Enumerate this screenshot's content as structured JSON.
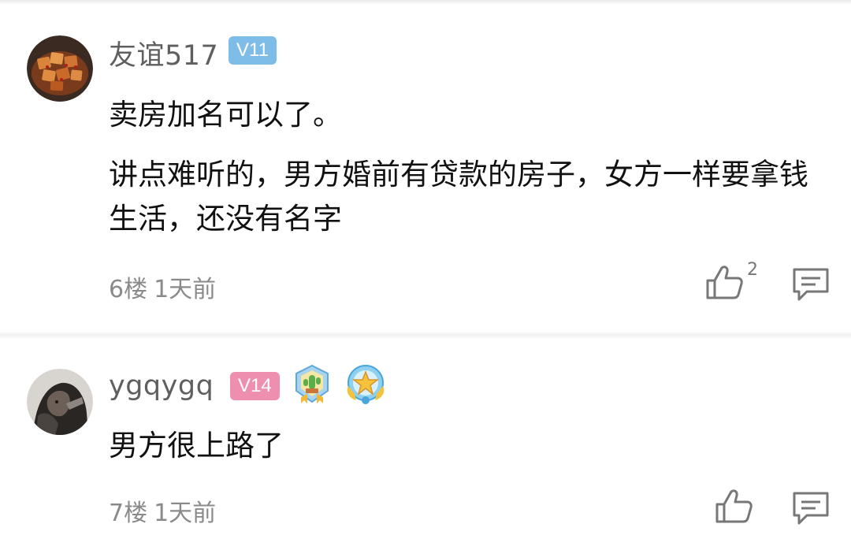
{
  "comments": [
    {
      "username": "友谊517",
      "level": "V11",
      "paragraphs": [
        "卖房加名可以了。",
        "讲点难听的，男方婚前有贷款的房子，女方一样要拿钱生活，还没有名字"
      ],
      "floor": "6楼",
      "time": "1天前",
      "likes": "2",
      "avatar_icon": "food-tofu-avatar",
      "icons": [
        "thumbs-up-icon",
        "reply-icon"
      ]
    },
    {
      "username": "ygqygq",
      "level": "V14",
      "paragraphs": [
        "男方很上路了"
      ],
      "floor": "7楼",
      "time": "1天前",
      "likes": "",
      "avatar_icon": "dark-portrait-avatar",
      "badges": [
        "cactus-medal-icon",
        "star-medal-icon"
      ],
      "icons": [
        "thumbs-up-icon",
        "reply-icon"
      ]
    }
  ],
  "colors": {
    "level_v11": "#7fbde9",
    "level_v14": "#ef8fb0",
    "meta_text": "#8a8a8a",
    "username_text": "#5f5f5f"
  }
}
